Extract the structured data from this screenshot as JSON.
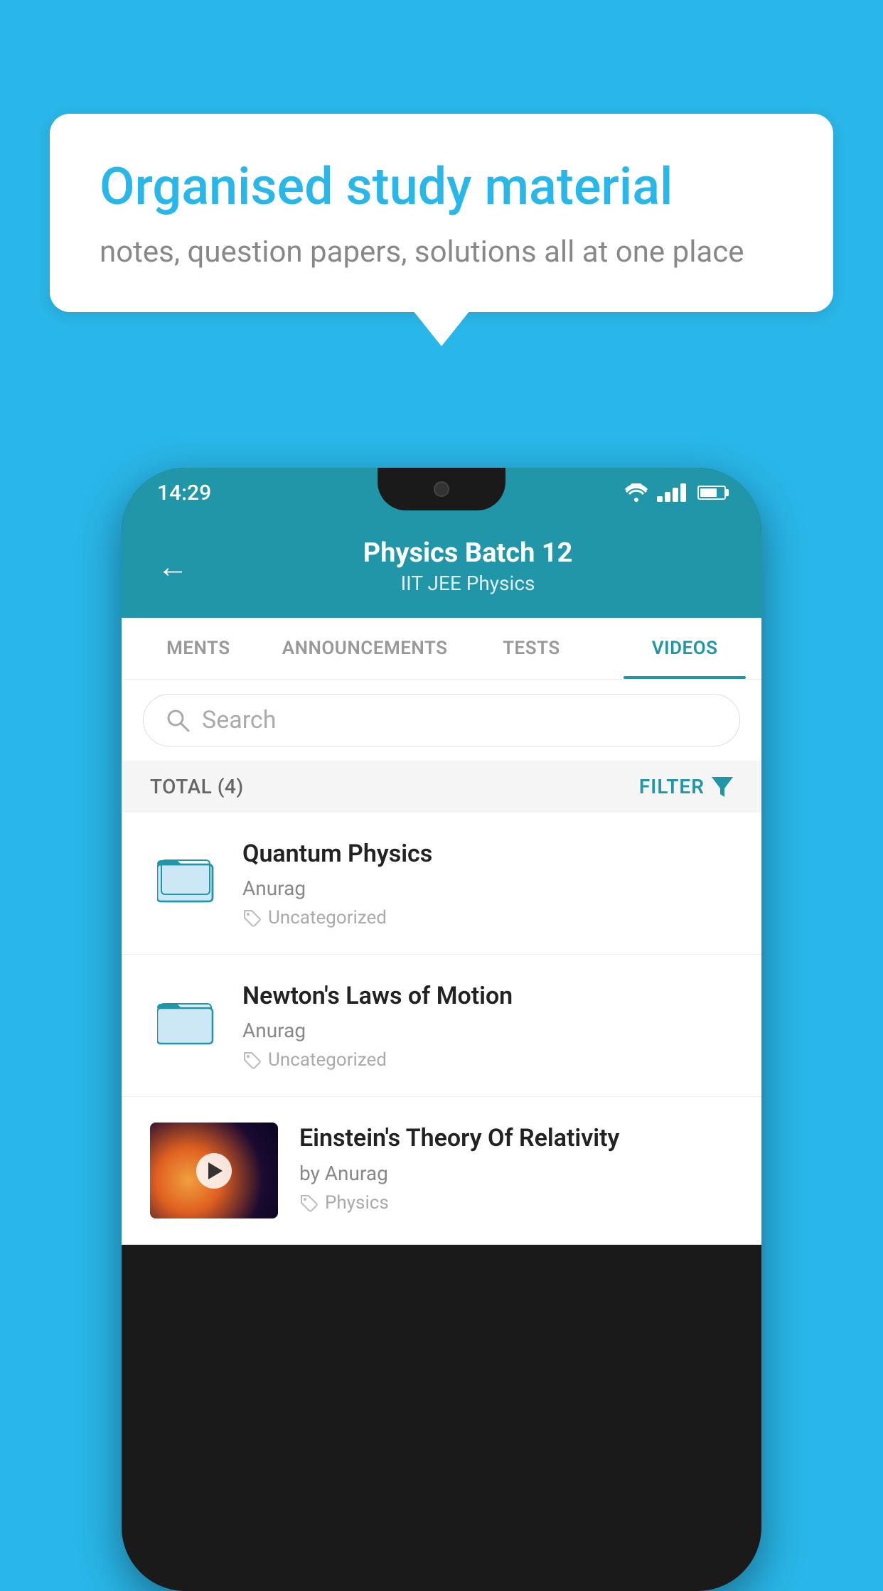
{
  "background_color": "#29b6e8",
  "speech_bubble": {
    "title": "Organised study material",
    "subtitle": "notes, question papers, solutions all at one place"
  },
  "status_bar": {
    "time": "14:29"
  },
  "app_header": {
    "title": "Physics Batch 12",
    "subtitle": "IIT JEE    Physics",
    "back_label": "←"
  },
  "tabs": [
    {
      "label": "MENTS",
      "active": false
    },
    {
      "label": "ANNOUNCEMENTS",
      "active": false
    },
    {
      "label": "TESTS",
      "active": false
    },
    {
      "label": "VIDEOS",
      "active": true
    }
  ],
  "search": {
    "placeholder": "Search"
  },
  "filter_bar": {
    "total_label": "TOTAL (4)",
    "filter_label": "FILTER"
  },
  "videos": [
    {
      "id": 1,
      "title": "Quantum Physics",
      "author": "Anurag",
      "tag": "Uncategorized",
      "type": "folder",
      "has_thumbnail": false
    },
    {
      "id": 2,
      "title": "Newton's Laws of Motion",
      "author": "Anurag",
      "tag": "Uncategorized",
      "type": "folder",
      "has_thumbnail": false
    },
    {
      "id": 3,
      "title": "Einstein's Theory Of Relativity",
      "author": "by Anurag",
      "tag": "Physics",
      "type": "video",
      "has_thumbnail": true
    }
  ]
}
